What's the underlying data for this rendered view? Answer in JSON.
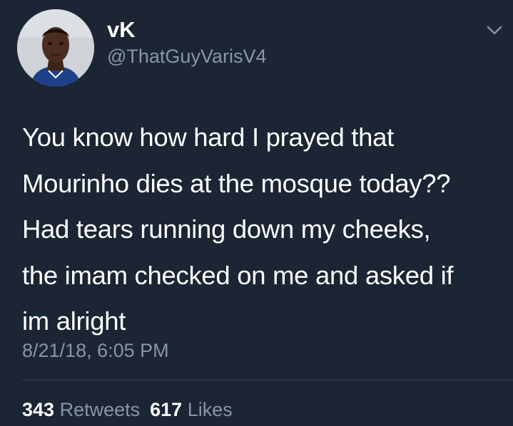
{
  "user": {
    "display_name": "vK",
    "handle": "@ThatGuyVarisV4"
  },
  "tweet": {
    "lines": [
      "You know how hard I prayed that",
      "Mourinho dies at the mosque today??",
      "Had tears running down my cheeks,",
      "the imam checked on me and asked if",
      "im alright"
    ],
    "timestamp": "8/21/18, 6:05 PM"
  },
  "stats": {
    "retweets_count": "343",
    "retweets_label": "Retweets",
    "likes_count": "617",
    "likes_label": "Likes"
  },
  "icons": {
    "menu": "chevron-down-icon",
    "avatar": "profile-photo"
  },
  "colors": {
    "background": "#1b2533",
    "primary_text": "#ffffff",
    "secondary_text": "#8a96a3"
  }
}
